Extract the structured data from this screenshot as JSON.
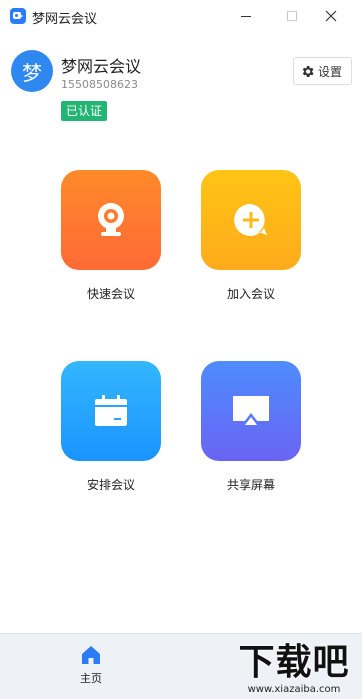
{
  "window": {
    "title": "梦网云会议",
    "controls": [
      "minimize",
      "maximize",
      "close"
    ]
  },
  "user": {
    "avatar_text": "梦",
    "name": "梦网云会议",
    "phone": "15508508623",
    "status_badge": "已认证"
  },
  "header": {
    "settings_label": "设置"
  },
  "actions": [
    {
      "label": "快速会议",
      "icon": "webcam-icon",
      "color": "#ff7a2f"
    },
    {
      "label": "加入会议",
      "icon": "plus-bubble-icon",
      "color": "#ffb81a"
    },
    {
      "label": "安排会议",
      "icon": "calendar-icon",
      "color": "#28a6ff"
    },
    {
      "label": "共享屏幕",
      "icon": "screen-share-icon",
      "color": "#5b78f8"
    }
  ],
  "nav": {
    "items": [
      {
        "label": "主页",
        "icon": "home-icon",
        "active": true
      }
    ]
  },
  "watermark": {
    "text": "下载吧",
    "url": "www.xiazaiba.com"
  },
  "colors": {
    "accent": "#2b7cf6",
    "badge_green": "#22b573"
  }
}
